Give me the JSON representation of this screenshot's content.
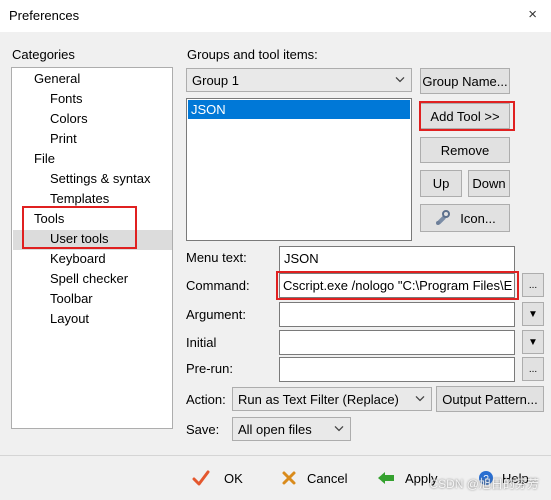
{
  "window": {
    "title": "Preferences",
    "close_icon": "×"
  },
  "categories": {
    "label": "Categories",
    "items": [
      {
        "label": "General"
      },
      {
        "label": "Fonts"
      },
      {
        "label": "Colors"
      },
      {
        "label": "Print"
      },
      {
        "label": "File"
      },
      {
        "label": "Settings & syntax"
      },
      {
        "label": "Templates"
      },
      {
        "label": "Tools"
      },
      {
        "label": "User tools"
      },
      {
        "label": "Keyboard"
      },
      {
        "label": "Spell checker"
      },
      {
        "label": "Toolbar"
      },
      {
        "label": "Layout"
      }
    ],
    "selected": "User tools"
  },
  "groups": {
    "label": "Groups and tool items:",
    "group_select_value": "Group 1",
    "group_name_button": "Group Name...",
    "items": [
      "JSON"
    ],
    "selected_item": "JSON",
    "add_tool_button": "Add Tool >>",
    "remove_button": "Remove",
    "up_button": "Up",
    "down_button": "Down",
    "icon_button": "Icon..."
  },
  "fields": {
    "menu_text_label": "Menu text:",
    "menu_text_value": "JSON",
    "command_label": "Command:",
    "command_value": "Cscript.exe /nologo \"C:\\Program Files\\E",
    "argument_label": "Argument:",
    "argument_value": "",
    "initial_label": "Initial",
    "initial_value": "",
    "prerun_label": "Pre-run:",
    "prerun_value": "",
    "browse_label": "...",
    "dropdown_glyph": "▼"
  },
  "action": {
    "label": "Action:",
    "value": "Run as Text Filter (Replace)",
    "output_pattern_button": "Output Pattern..."
  },
  "save": {
    "label": "Save:",
    "value": "All open files"
  },
  "footer": {
    "ok": "OK",
    "cancel": "Cancel",
    "apply": "Apply",
    "help": "Help"
  },
  "watermark": "CSDN @旭日的芬芳",
  "colors": {
    "highlight_red": "#e02020",
    "selection_blue": "#0078d7"
  }
}
